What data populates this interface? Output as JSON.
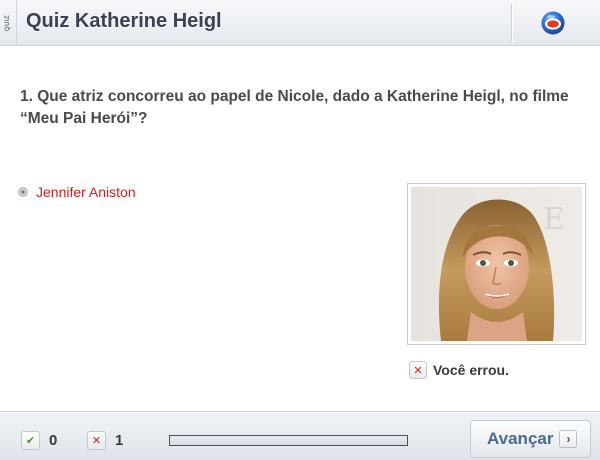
{
  "header": {
    "side_tab": "QUIZ",
    "title": "Quiz Katherine Heigl",
    "logo_icon": "globo-logo-icon"
  },
  "question": {
    "text": "1. Que atriz concorreu ao papel de Nicole, dado a Katherine Heigl, no filme “Meu Pai Herói”?"
  },
  "answer": {
    "label": "Jennifer Aniston",
    "color": "#d3211c"
  },
  "result": {
    "icon": "x-icon",
    "text": "Você errou."
  },
  "footer": {
    "correct_count": "0",
    "wrong_count": "1",
    "progress_fraction": 0,
    "next_label": "Avançar",
    "next_icon": "chevron-right-icon"
  }
}
